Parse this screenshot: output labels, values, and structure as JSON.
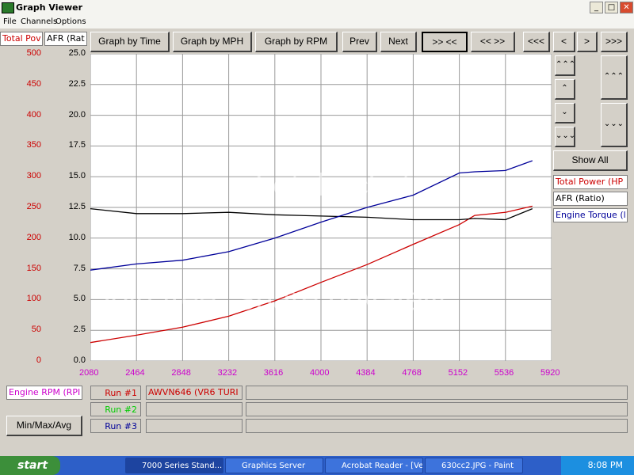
{
  "window": {
    "title": "Graph Viewer",
    "minimize": "_",
    "maximize": "□",
    "close": "✕"
  },
  "menu": [
    "File",
    "Channels",
    "Options"
  ],
  "header_labels": {
    "left1": "Total Pov",
    "left2": "AFR (Rat"
  },
  "toolbar": [
    "Graph by Time",
    "Graph by MPH",
    "Graph by RPM",
    "Prev",
    "Next",
    ">> <<",
    "<< >>",
    "<<<",
    "<",
    ">",
    ">>>"
  ],
  "y_left": {
    "color": "#cc0000",
    "ticks": [
      "500",
      "450",
      "400",
      "350",
      "300",
      "250",
      "200",
      "150",
      "100",
      "50",
      "0"
    ]
  },
  "y_right": {
    "color": "#000000",
    "ticks": [
      "25.0",
      "22.5",
      "20.0",
      "17.5",
      "15.0",
      "12.5",
      "10.0",
      "7.5",
      "5.0",
      "2.5",
      "0.0"
    ]
  },
  "side_buttons": [
    "⌃⌃⌃",
    "⌃",
    "⌄",
    "⌄⌄⌄",
    "⌃⌃⌃",
    "⌄⌄⌄"
  ],
  "show_all": "Show All",
  "legend": [
    {
      "label": "Total Power (HP",
      "color": "#cc0000"
    },
    {
      "label": "AFR (Ratio)",
      "color": "#000000"
    },
    {
      "label": "Engine Torque (l",
      "color": "#000099"
    }
  ],
  "x_axis": {
    "color": "#cc00cc",
    "ticks": [
      "2080",
      "2464",
      "2848",
      "3232",
      "3616",
      "4000",
      "4384",
      "4768",
      "5152",
      "5536",
      "5920"
    ],
    "label": "Engine RPM (RPI"
  },
  "runs": [
    {
      "label": "Run #1",
      "color": "#cc0000",
      "name": "AWVN646 (VR6 TURI"
    },
    {
      "label": "Run #2",
      "color": "#00cc00",
      "name": ""
    },
    {
      "label": "Run #3",
      "color": "#000099",
      "name": ""
    }
  ],
  "minmax_button": "Min/Max/Avg",
  "watermark": {
    "top": "photobucket",
    "bottom": "Join free. Share privately."
  },
  "chart_data": {
    "type": "line",
    "x": [
      2080,
      2464,
      2848,
      3232,
      3616,
      4000,
      4384,
      4768,
      5152,
      5280,
      5536,
      5760
    ],
    "xlim": [
      2080,
      5920
    ],
    "series": [
      {
        "name": "Total Power (HP",
        "axis": "left",
        "color": "#cc0000",
        "values": [
          30,
          42,
          55,
          73,
          98,
          128,
          157,
          190,
          222,
          237,
          242,
          252
        ]
      },
      {
        "name": "AFR (Ratio)",
        "axis": "right",
        "color": "#000000",
        "values": [
          12.4,
          12.0,
          12.0,
          12.1,
          11.9,
          11.8,
          11.7,
          11.5,
          11.5,
          11.6,
          11.5,
          12.4
        ]
      },
      {
        "name": "Engine Torque (l",
        "axis": "right",
        "color": "#000099",
        "values": [
          7.4,
          7.9,
          8.2,
          8.9,
          10.0,
          11.3,
          12.5,
          13.5,
          15.3,
          15.4,
          15.5,
          16.3
        ]
      }
    ],
    "ylim_left": [
      0,
      500
    ],
    "ylim_right": [
      0,
      25
    ],
    "grid": true
  },
  "taskbar": {
    "start": "start",
    "tasks": [
      "7000 Series Stand...",
      "Graphics Server",
      "Acrobat Reader - [Ve...",
      "630cc2.JPG - Paint"
    ],
    "clock": "8:08 PM"
  }
}
